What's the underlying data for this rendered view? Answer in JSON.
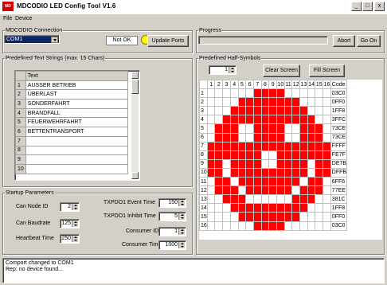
{
  "window": {
    "title": "MDCODIO LED Config Tool V1.6",
    "min": "_",
    "max": "□",
    "close": "x"
  },
  "menu": [
    "File",
    "Device"
  ],
  "connection": {
    "legend": "MDCODIO Connection",
    "port": "COM1",
    "status": "Not OK",
    "status_color": "#ffff00",
    "update_label": "Update Ports"
  },
  "progress": {
    "legend": "Progress",
    "abort_label": "Abort",
    "go_label": "Go On"
  },
  "texts": {
    "legend": "Predefined Text Strings (max. 15 Chars)",
    "header": "Text",
    "rows": [
      [
        "1",
        "AUSSER BETRIEB"
      ],
      [
        "2",
        "ÜBERLAST"
      ],
      [
        "3",
        "SONDERFAHRT"
      ],
      [
        "4",
        "BRANDFALL"
      ],
      [
        "5",
        "FEUERWEHRFAHRT"
      ],
      [
        "6",
        "BETTENTRANSPORT"
      ],
      [
        "7",
        ""
      ],
      [
        "8",
        ""
      ],
      [
        "9",
        ""
      ],
      [
        "10",
        ""
      ]
    ]
  },
  "halfsymbols": {
    "legend": "Predefined Half-Symbols",
    "selected": "1",
    "clear_label": "Clear Screen",
    "fill_label": "Fill Screen",
    "code_header": "Code",
    "columns": [
      "1",
      "2",
      "3",
      "4",
      "5",
      "6",
      "7",
      "8",
      "9",
      "10",
      "11",
      "12",
      "13",
      "14",
      "15",
      "16"
    ],
    "codes": [
      "03C0",
      "0FF0",
      "1FF8",
      "3FFC",
      "73CE",
      "73CE",
      "FFFF",
      "FE7F",
      "DE7B",
      "DFFB",
      "6FF6",
      "77EE",
      "381C",
      "1FF8",
      "0FF0",
      "03C0"
    ],
    "on_color": "#ff0000"
  },
  "startup": {
    "legend": "Startup Parameters",
    "can_node_label": "Can Node ID",
    "can_node": "2",
    "baud_label": "Can Baudrate",
    "baud": "125",
    "heartbeat_label": "Heartbeat Time",
    "heartbeat": "250",
    "event_label": "TXPDO1 Event Time",
    "event": "150",
    "inhibit_label": "TXPDO1 Inhibit Time",
    "inhibit": "5",
    "consumer_id_label": "Consumer ID",
    "consumer_id": "1",
    "consumer_time_label": "Consumer Time",
    "consumer_time": "1000"
  },
  "log": [
    "Comport changed to COM1",
    "Rep: no device found..."
  ]
}
